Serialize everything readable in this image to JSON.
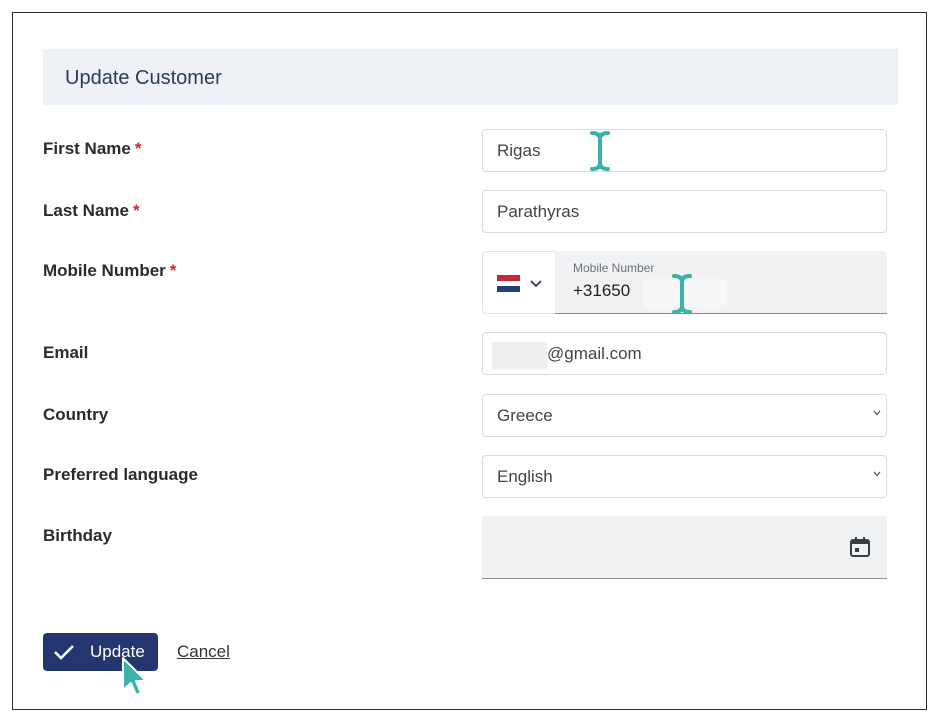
{
  "form": {
    "title": "Update Customer",
    "required_marker": "*",
    "first_name": {
      "label": "First Name",
      "value": "Rigas"
    },
    "last_name": {
      "label": "Last Name",
      "value": "Parathyras"
    },
    "mobile": {
      "label": "Mobile Number",
      "float_label": "Mobile Number",
      "value": "+31650",
      "country_flag": "netherlands-flag"
    },
    "email": {
      "label": "Email",
      "value": "@gmail.com"
    },
    "country": {
      "label": "Country",
      "value": "Greece"
    },
    "language": {
      "label": "Preferred language",
      "value": "English"
    },
    "birthday": {
      "label": "Birthday",
      "value": ""
    }
  },
  "actions": {
    "update_label": "Update",
    "cancel_label": "Cancel"
  },
  "colors": {
    "primary": "#233670",
    "required": "#d9232d",
    "header_bg": "#eef1f5",
    "cursor": "#3bb3a8"
  }
}
